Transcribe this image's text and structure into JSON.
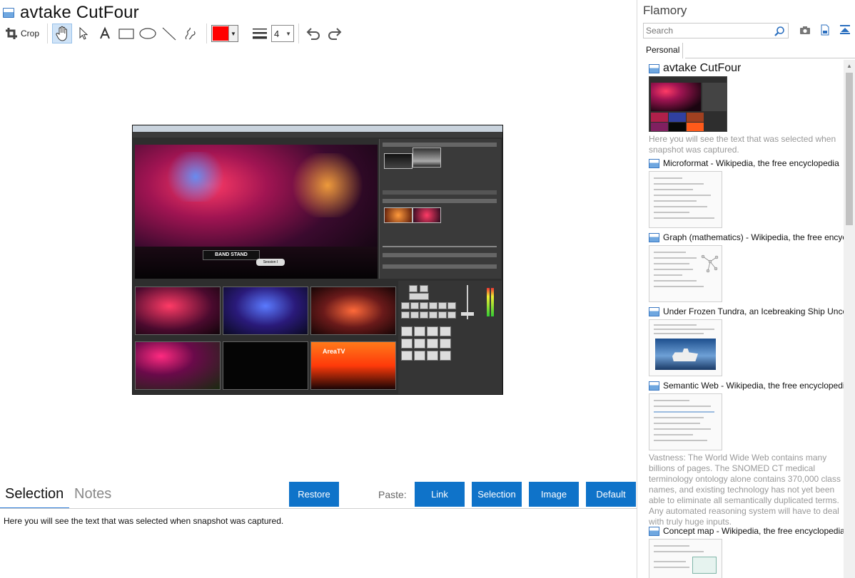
{
  "document": {
    "title": "avtake CutFour"
  },
  "toolbar": {
    "crop_label": "Crop",
    "line_width_value": "4",
    "current_color": "#ff0000"
  },
  "bottom": {
    "tabs": [
      "Selection",
      "Notes"
    ],
    "restore_label": "Restore",
    "paste_label": "Paste:",
    "paste_buttons": [
      "Link",
      "Selection",
      "Image",
      "Default"
    ],
    "notes_text": "Here you will see the text that was selected when snapshot was captured."
  },
  "sidebar": {
    "title": "Flamory",
    "search_placeholder": "Search",
    "tab_label": "Personal",
    "items": [
      {
        "title": "avtake CutFour",
        "desc": "Here you will see the text that was selected when snapshot was captured."
      },
      {
        "title": "Microformat - Wikipedia, the free encyclopedia"
      },
      {
        "title": "Graph (mathematics) - Wikipedia, the free encyclopedia"
      },
      {
        "title": "Under Frozen Tundra, an Icebreaking Ship Uncovers"
      },
      {
        "title": "Semantic Web - Wikipedia, the free encyclopedia",
        "desc": "Vastness: The World Wide Web contains many billions of pages. The SNOMED CT medical terminology ontology alone contains 370,000 class names, and existing technology has not yet been able to eliminate all semantically duplicated terms. Any automated reasoning system will have to deal with truly huge inputs."
      },
      {
        "title": "Concept map - Wikipedia, the free encyclopedia"
      }
    ]
  },
  "snapshot": {
    "band_text": "BAND STAND",
    "session_text": "Session I",
    "area_text": "AreaTV"
  },
  "colors": {
    "accent": "#0f73c9",
    "tab_underline": "#2b7bd6"
  }
}
